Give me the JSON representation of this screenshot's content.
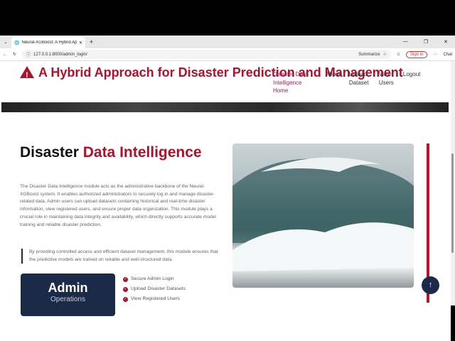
{
  "browser": {
    "tab_title": "Neural-XGBoost: A Hybrid Approa",
    "url": "127.0.0.1:8000/admin_login/",
    "summarize": "Summarize",
    "sign_in": "Sign in",
    "chat": "Chat"
  },
  "header": {
    "brand": "A Hybrid Approach for Disaster Prediction and Management",
    "nav": [
      "Disaster Data Intelligence Home",
      "About",
      "Upload Dataset",
      "View Users",
      "Logout"
    ]
  },
  "main": {
    "title_dark": "Disaster ",
    "title_red": "Data Intelligence",
    "description": "The Disaster Data Intelligence module acts as the administrative backbone of the Neural-XGBoost system. It enables authorized administrators to securely log in and manage disaster-related data. Admin users can upload datasets containing historical and real-time disaster information, view registered users, and ensure proper data organization. This module plays a crucial role in maintaining data integrity and availability, which directly supports accurate model training and reliable disaster prediction.",
    "quote": "By providing controlled access and efficient dataset management, this module ensures that the predictive models are trained on reliable and well-structured data.",
    "card_title": "Admin",
    "card_sub": "Operations",
    "features": [
      "Secure Admin Login",
      "Upload Disaster Datasets",
      "View Registered Users"
    ]
  },
  "colors": {
    "accent": "#b0102a",
    "navy": "#1c2a4a"
  }
}
